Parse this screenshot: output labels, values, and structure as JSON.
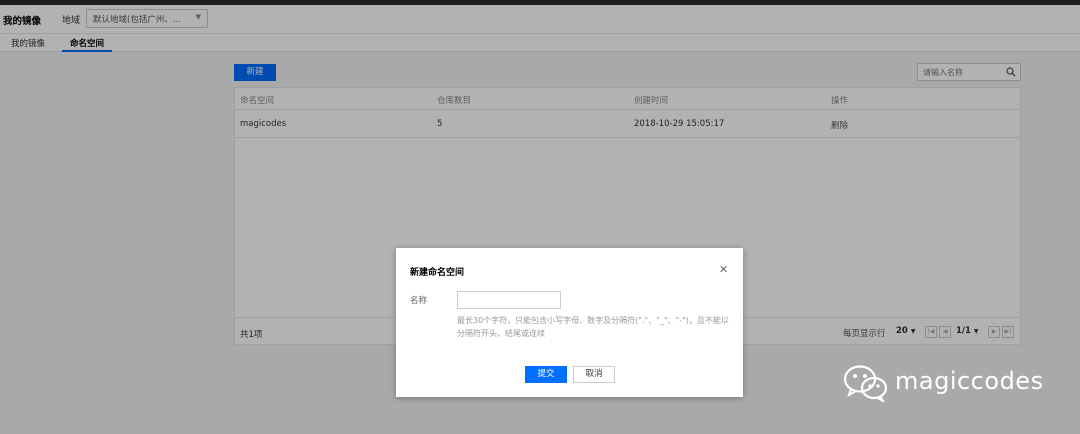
{
  "header": {
    "page_title": "我的镜像",
    "region_label": "地域",
    "region_value": "默认地域(包括广州、..."
  },
  "tabs": [
    {
      "label": "我的镜像",
      "active": false
    },
    {
      "label": "命名空间",
      "active": true
    }
  ],
  "toolbar": {
    "new_label": "新建",
    "search_placeholder": "请输入名称"
  },
  "table": {
    "columns": [
      "命名空间",
      "仓库数目",
      "创建时间",
      "操作"
    ],
    "rows": [
      {
        "namespace": "magicodes",
        "repo_count": "5",
        "created": "2018-10-29 15:05:17",
        "action": "删除"
      }
    ],
    "footer": {
      "total": "共1项",
      "per_page_label": "每页显示行",
      "per_page_value": "20",
      "page": "1/1"
    }
  },
  "dialog": {
    "title": "新建命名空间",
    "name_label": "名称",
    "name_value": "",
    "help_text": "最长30个字符，只能包含小写字母、数字及分隔符(\".\"、\"_\"、\"-\")，且不能以分隔符开头、结尾或连续",
    "submit_label": "提交",
    "cancel_label": "取消"
  },
  "watermark": {
    "text": "magiccodes"
  },
  "colors": {
    "accent": "#006eff",
    "overlay": "rgba(0,0,0,0.3)",
    "topbar": "#2b2b2b"
  }
}
